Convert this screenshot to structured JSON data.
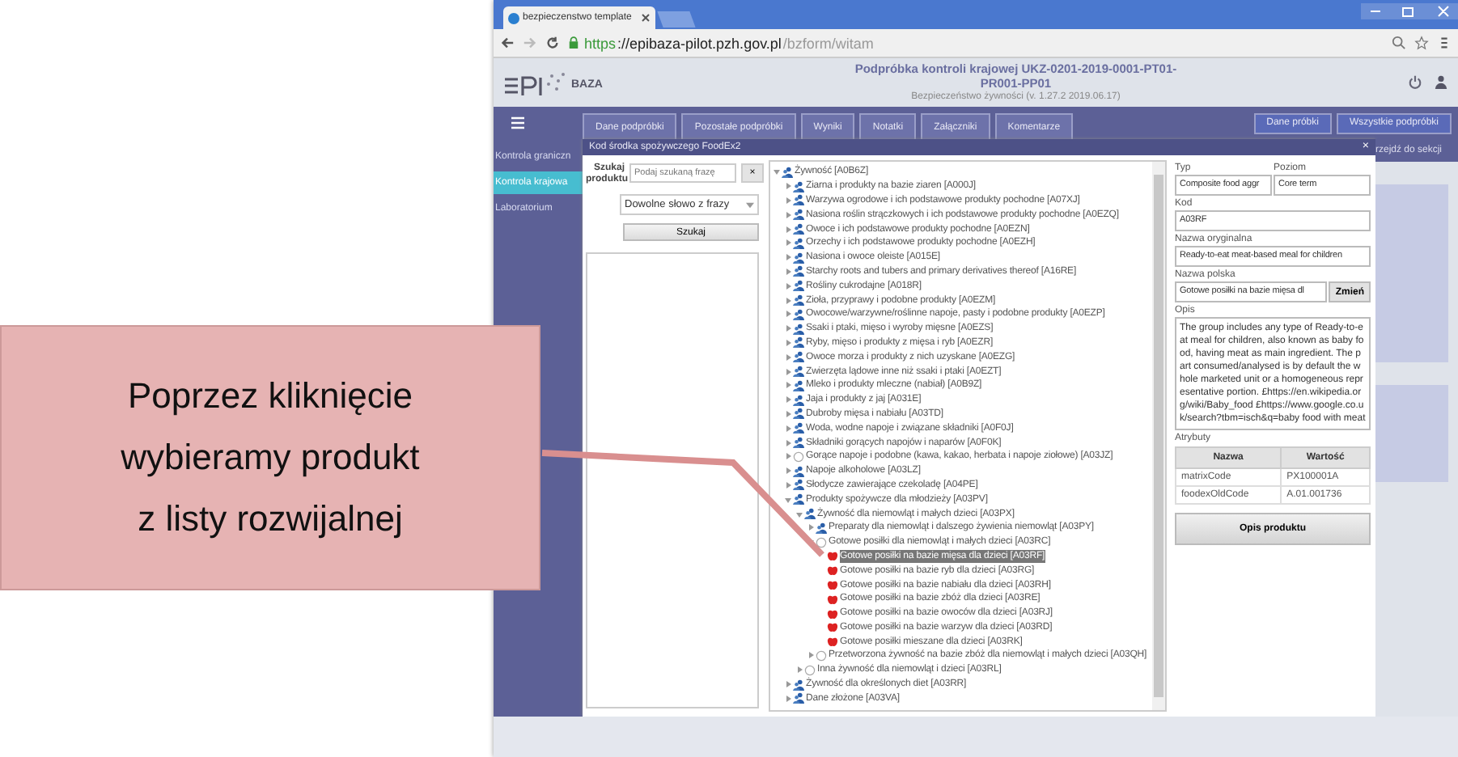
{
  "browser": {
    "tab_title": "bezpieczenstwo template",
    "address": {
      "scheme": "https",
      "host": "://epibaza-pilot.pzh.gov.pl",
      "path": "/bzform/witam"
    }
  },
  "header": {
    "logo_text": "BAZA",
    "title_lines": [
      "Podpróbka kontroli krajowej UKZ-0201-2019-0001-PT01-",
      "PR001-PP01"
    ],
    "subtitle": "Bezpieczeństwo żywności (v. 1.27.2 2019.06.17)"
  },
  "nav_tabs": [
    "Dane podpróbki",
    "Pozostałe podpróbki",
    "Wyniki",
    "Notatki",
    "Załączniki",
    "Komentarze"
  ],
  "right_buttons": [
    "Dane próbki",
    "Wszystkie podpróbki"
  ],
  "sidebar": {
    "items": [
      {
        "label": "Kontrola graniczn",
        "selected": false
      },
      {
        "label": "Kontrola krajowa",
        "selected": true
      },
      {
        "label": "Laboratorium",
        "selected": false
      }
    ]
  },
  "section_link": "rzejdź do sekcji",
  "modal": {
    "title": "Kod środka spożywczego FoodEx2",
    "close": "×",
    "search": {
      "label": "Szukaj produktu",
      "placeholder": "Podaj szukaną frazę",
      "clear": "×",
      "mode": "Dowolne słowo z frazy",
      "button": "Szukaj"
    },
    "tree": [
      {
        "label": "Żywność [A0B6Z]",
        "kind": "group",
        "expanded": true,
        "selected": false,
        "children": [
          {
            "label": "Ziarna i produkty na bazie ziaren [A000J]",
            "kind": "group",
            "expanded": false,
            "selected": false
          },
          {
            "label": "Warzywa ogrodowe i ich podstawowe produkty pochodne [A07XJ]",
            "kind": "group",
            "expanded": false,
            "selected": false
          },
          {
            "label": "Nasiona roślin strączkowych i ich podstawowe produkty pochodne [A0EZQ]",
            "kind": "group",
            "expanded": false,
            "selected": false
          },
          {
            "label": "Owoce i ich podstawowe produkty pochodne [A0EZN]",
            "kind": "group",
            "expanded": false,
            "selected": false
          },
          {
            "label": "Orzechy i ich podstawowe produkty pochodne [A0EZH]",
            "kind": "group",
            "expanded": false,
            "selected": false
          },
          {
            "label": "Nasiona i owoce oleiste [A015E]",
            "kind": "group",
            "expanded": false,
            "selected": false
          },
          {
            "label": "Starchy roots and tubers and primary derivatives thereof [A16RE]",
            "kind": "group",
            "expanded": false,
            "selected": false
          },
          {
            "label": "Rośliny cukrodajne [A018R]",
            "kind": "group",
            "expanded": false,
            "selected": false
          },
          {
            "label": "Zioła, przyprawy i podobne produkty [A0EZM]",
            "kind": "group",
            "expanded": false,
            "selected": false
          },
          {
            "label": "Owocowe/warzywne/roślinne napoje, pasty i podobne produkty [A0EZP]",
            "kind": "group",
            "expanded": false,
            "selected": false
          },
          {
            "label": "Ssaki i ptaki, mięso i wyroby mięsne [A0EZS]",
            "kind": "group",
            "expanded": false,
            "selected": false
          },
          {
            "label": "Ryby, mięso i produkty z mięsa i ryb [A0EZR]",
            "kind": "group",
            "expanded": false,
            "selected": false
          },
          {
            "label": "Owoce morza i produkty z nich uzyskane [A0EZG]",
            "kind": "group",
            "expanded": false,
            "selected": false
          },
          {
            "label": "Zwierzęta lądowe inne niż ssaki i ptaki [A0EZT]",
            "kind": "group",
            "expanded": false,
            "selected": false
          },
          {
            "label": "Mleko i produkty mleczne (nabiał) [A0B9Z]",
            "kind": "group",
            "expanded": false,
            "selected": false
          },
          {
            "label": "Jaja i produkty z jaj [A031E]",
            "kind": "group",
            "expanded": false,
            "selected": false
          },
          {
            "label": "Dubroby mięsa i nabiału [A03TD]",
            "kind": "group",
            "expanded": false,
            "selected": false
          },
          {
            "label": "Woda, wodne napoje i związane składniki [A0F0J]",
            "kind": "group",
            "expanded": false,
            "selected": false
          },
          {
            "label": "Składniki gorących napojów i naparów [A0F0K]",
            "kind": "group",
            "expanded": false,
            "selected": false
          },
          {
            "label": "Gorące napoje i podobne (kawa, kakao, herbata i napoje ziołowe) [A03JZ]",
            "kind": "empty",
            "expanded": false,
            "selected": false
          },
          {
            "label": "Napoje alkoholowe [A03LZ]",
            "kind": "group",
            "expanded": false,
            "selected": false
          },
          {
            "label": "Słodycze zawierające czekoladę [A04PE]",
            "kind": "group",
            "expanded": false,
            "selected": false
          },
          {
            "label": "Produkty spożywcze dla młodzieży [A03PV]",
            "kind": "group",
            "expanded": true,
            "selected": false,
            "children": [
              {
                "label": "Żywność dla niemowląt i małych dzieci [A03PX]",
                "kind": "group",
                "expanded": true,
                "selected": false,
                "children": [
                  {
                    "label": "Preparaty dla niemowląt i dalszego żywienia niemowląt [A03PY]",
                    "kind": "group",
                    "expanded": false,
                    "selected": false
                  },
                  {
                    "label": "Gotowe posiłki dla niemowląt i małych dzieci [A03RC]",
                    "kind": "empty",
                    "expanded": true,
                    "selected": false,
                    "children": [
                      {
                        "label": "Gotowe posiłki na bazie mięsa dla dzieci [A03RF]",
                        "kind": "leaf",
                        "selected": true
                      },
                      {
                        "label": "Gotowe posiłki na bazie ryb dla dzieci [A03RG]",
                        "kind": "leaf",
                        "selected": false
                      },
                      {
                        "label": "Gotowe posiłki na bazie nabiału dla dzieci [A03RH]",
                        "kind": "leaf",
                        "selected": false
                      },
                      {
                        "label": "Gotowe posiłki na bazie zbóż dla dzieci [A03RE]",
                        "kind": "leaf",
                        "selected": false
                      },
                      {
                        "label": "Gotowe posiłki na bazie owoców dla dzieci [A03RJ]",
                        "kind": "leaf",
                        "selected": false
                      },
                      {
                        "label": "Gotowe posiłki na bazie warzyw dla dzieci [A03RD]",
                        "kind": "leaf",
                        "selected": false
                      },
                      {
                        "label": "Gotowe posiłki mieszane dla dzieci [A03RK]",
                        "kind": "leaf",
                        "selected": false
                      }
                    ]
                  },
                  {
                    "label": "Przetworzona żywność na bazie zbóż dla niemowląt i małych dzieci [A03QH]",
                    "kind": "empty",
                    "expanded": false,
                    "selected": false
                  }
                ]
              },
              {
                "label": "Inna żywność dla niemowląt i dzieci [A03RL]",
                "kind": "empty",
                "expanded": false,
                "selected": false
              }
            ]
          },
          {
            "label": "Żywność dla określonych diet [A03RR]",
            "kind": "group",
            "expanded": false,
            "selected": false
          },
          {
            "label": "Dane złożone [A03VA]",
            "kind": "group",
            "expanded": false,
            "selected": false
          }
        ]
      }
    ],
    "details": {
      "type_label": "Typ",
      "type_value": "Composite food aggr",
      "level_label": "Poziom",
      "level_value": "Core term",
      "code_label": "Kod",
      "code_value": "A03RF",
      "original_label": "Nazwa oryginalna",
      "original_value": "Ready-to-eat meat-based meal for children",
      "polish_label": "Nazwa polska",
      "polish_value": "Gotowe posiłki na bazie mięsa dl",
      "change_button": "Zmień",
      "description_label": "Opis",
      "description": "The group includes any type of Ready-to-eat meal for children, also known as baby food, having meat as main ingredient. The part consumed/analysed is by default the whole marketed unit or a homogeneous representative portion. £https://en.wikipedia.org/wiki/Baby_food £https://www.google.co.uk/search?tbm=isch&q=baby food with meat",
      "attributes_label": "Atrybuty",
      "attributes": {
        "columns": [
          "Nazwa",
          "Wartość"
        ],
        "rows": [
          [
            "matrixCode",
            "PX100001A"
          ],
          [
            "foodexOldCode",
            "A.01.001736"
          ]
        ]
      },
      "product_button": "Opis produktu"
    }
  },
  "callout": {
    "text": "Poprzez kliknięcie wybieramy produkt z listy rozwijalnej"
  }
}
